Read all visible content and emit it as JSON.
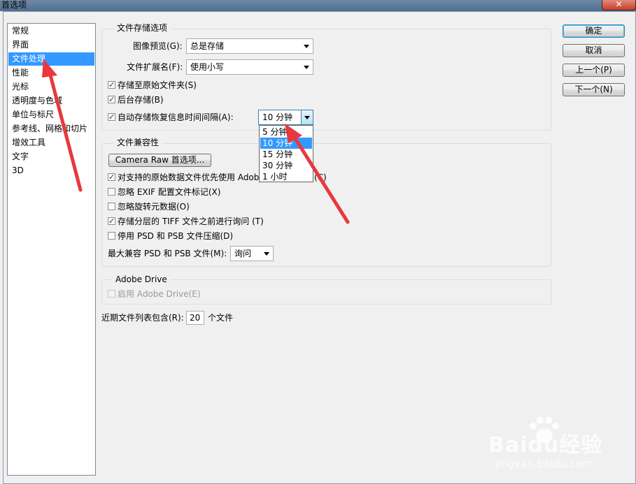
{
  "window": {
    "title": "首选项",
    "close_glyph": "✕"
  },
  "sidebar": {
    "items": [
      {
        "label": "常规"
      },
      {
        "label": "界面"
      },
      {
        "label": "文件处理"
      },
      {
        "label": "性能"
      },
      {
        "label": "光标"
      },
      {
        "label": "透明度与色域"
      },
      {
        "label": "单位与标尺"
      },
      {
        "label": "参考线、网格和切片"
      },
      {
        "label": "增效工具"
      },
      {
        "label": "文字"
      },
      {
        "label": "3D"
      }
    ],
    "selected": "文件处理"
  },
  "file_save": {
    "legend": "文件存储选项",
    "image_preview_label": "图像预览(G):",
    "image_preview_value": "总是存储",
    "file_ext_label": "文件扩展名(F):",
    "file_ext_value": "使用小写",
    "save_to_original_label": "存储至原始文件夹(S)",
    "background_save_label": "后台存储(B)",
    "autosave_label": "自动存储恢复信息时间间隔(A):",
    "autosave_value": "10 分钟",
    "autosave_options": [
      "5 分钟",
      "10 分钟",
      "15 分钟",
      "30 分钟",
      "1 小时"
    ]
  },
  "compat": {
    "legend": "文件兼容性",
    "camera_raw_button": "Camera Raw 首选项...",
    "prefer_acr_label": "对支持的原始数据文件优先使用 Adob",
    "prefer_acr_suffix": "(C)",
    "ignore_exif_label": "忽略 EXIF 配置文件标记(X)",
    "ignore_rotation_label": "忽略旋转元数据(O)",
    "ask_tiff_label": "存储分层的 TIFF 文件之前进行询问 (T)",
    "disable_compress_label": "停用 PSD 和 PSB 文件压缩(D)",
    "max_compat_label": "最大兼容 PSD 和 PSB 文件(M):",
    "max_compat_value": "询问"
  },
  "drive": {
    "legend": "Adobe Drive",
    "enable_label": "启用 Adobe Drive(E)"
  },
  "recent": {
    "label": "近期文件列表包含(R):",
    "value": "20",
    "suffix": "个文件"
  },
  "buttons": {
    "ok": "确定",
    "cancel": "取消",
    "prev": "上一个(P)",
    "next": "下一个(N)"
  },
  "watermark": {
    "brand": "Baidu经验",
    "url": "jingyan.baidu.com"
  },
  "colors": {
    "selection": "#3399ff",
    "annotation_arrow": "#e8383d"
  }
}
